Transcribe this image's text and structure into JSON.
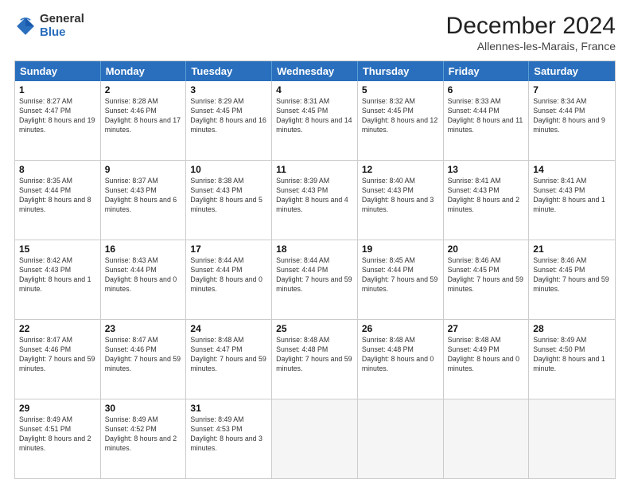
{
  "header": {
    "logo": {
      "general": "General",
      "blue": "Blue"
    },
    "title": "December 2024",
    "location": "Allennes-les-Marais, France"
  },
  "days": [
    "Sunday",
    "Monday",
    "Tuesday",
    "Wednesday",
    "Thursday",
    "Friday",
    "Saturday"
  ],
  "weeks": [
    [
      {
        "day": 1,
        "info": "Sunrise: 8:27 AM\nSunset: 4:47 PM\nDaylight: 8 hours and 19 minutes."
      },
      {
        "day": 2,
        "info": "Sunrise: 8:28 AM\nSunset: 4:46 PM\nDaylight: 8 hours and 17 minutes."
      },
      {
        "day": 3,
        "info": "Sunrise: 8:29 AM\nSunset: 4:45 PM\nDaylight: 8 hours and 16 minutes."
      },
      {
        "day": 4,
        "info": "Sunrise: 8:31 AM\nSunset: 4:45 PM\nDaylight: 8 hours and 14 minutes."
      },
      {
        "day": 5,
        "info": "Sunrise: 8:32 AM\nSunset: 4:45 PM\nDaylight: 8 hours and 12 minutes."
      },
      {
        "day": 6,
        "info": "Sunrise: 8:33 AM\nSunset: 4:44 PM\nDaylight: 8 hours and 11 minutes."
      },
      {
        "day": 7,
        "info": "Sunrise: 8:34 AM\nSunset: 4:44 PM\nDaylight: 8 hours and 9 minutes."
      }
    ],
    [
      {
        "day": 8,
        "info": "Sunrise: 8:35 AM\nSunset: 4:44 PM\nDaylight: 8 hours and 8 minutes."
      },
      {
        "day": 9,
        "info": "Sunrise: 8:37 AM\nSunset: 4:43 PM\nDaylight: 8 hours and 6 minutes."
      },
      {
        "day": 10,
        "info": "Sunrise: 8:38 AM\nSunset: 4:43 PM\nDaylight: 8 hours and 5 minutes."
      },
      {
        "day": 11,
        "info": "Sunrise: 8:39 AM\nSunset: 4:43 PM\nDaylight: 8 hours and 4 minutes."
      },
      {
        "day": 12,
        "info": "Sunrise: 8:40 AM\nSunset: 4:43 PM\nDaylight: 8 hours and 3 minutes."
      },
      {
        "day": 13,
        "info": "Sunrise: 8:41 AM\nSunset: 4:43 PM\nDaylight: 8 hours and 2 minutes."
      },
      {
        "day": 14,
        "info": "Sunrise: 8:41 AM\nSunset: 4:43 PM\nDaylight: 8 hours and 1 minute."
      }
    ],
    [
      {
        "day": 15,
        "info": "Sunrise: 8:42 AM\nSunset: 4:43 PM\nDaylight: 8 hours and 1 minute."
      },
      {
        "day": 16,
        "info": "Sunrise: 8:43 AM\nSunset: 4:44 PM\nDaylight: 8 hours and 0 minutes."
      },
      {
        "day": 17,
        "info": "Sunrise: 8:44 AM\nSunset: 4:44 PM\nDaylight: 8 hours and 0 minutes."
      },
      {
        "day": 18,
        "info": "Sunrise: 8:44 AM\nSunset: 4:44 PM\nDaylight: 7 hours and 59 minutes."
      },
      {
        "day": 19,
        "info": "Sunrise: 8:45 AM\nSunset: 4:44 PM\nDaylight: 7 hours and 59 minutes."
      },
      {
        "day": 20,
        "info": "Sunrise: 8:46 AM\nSunset: 4:45 PM\nDaylight: 7 hours and 59 minutes."
      },
      {
        "day": 21,
        "info": "Sunrise: 8:46 AM\nSunset: 4:45 PM\nDaylight: 7 hours and 59 minutes."
      }
    ],
    [
      {
        "day": 22,
        "info": "Sunrise: 8:47 AM\nSunset: 4:46 PM\nDaylight: 7 hours and 59 minutes."
      },
      {
        "day": 23,
        "info": "Sunrise: 8:47 AM\nSunset: 4:46 PM\nDaylight: 7 hours and 59 minutes."
      },
      {
        "day": 24,
        "info": "Sunrise: 8:48 AM\nSunset: 4:47 PM\nDaylight: 7 hours and 59 minutes."
      },
      {
        "day": 25,
        "info": "Sunrise: 8:48 AM\nSunset: 4:48 PM\nDaylight: 7 hours and 59 minutes."
      },
      {
        "day": 26,
        "info": "Sunrise: 8:48 AM\nSunset: 4:48 PM\nDaylight: 8 hours and 0 minutes."
      },
      {
        "day": 27,
        "info": "Sunrise: 8:48 AM\nSunset: 4:49 PM\nDaylight: 8 hours and 0 minutes."
      },
      {
        "day": 28,
        "info": "Sunrise: 8:49 AM\nSunset: 4:50 PM\nDaylight: 8 hours and 1 minute."
      }
    ],
    [
      {
        "day": 29,
        "info": "Sunrise: 8:49 AM\nSunset: 4:51 PM\nDaylight: 8 hours and 2 minutes."
      },
      {
        "day": 30,
        "info": "Sunrise: 8:49 AM\nSunset: 4:52 PM\nDaylight: 8 hours and 2 minutes."
      },
      {
        "day": 31,
        "info": "Sunrise: 8:49 AM\nSunset: 4:53 PM\nDaylight: 8 hours and 3 minutes."
      },
      null,
      null,
      null,
      null
    ]
  ]
}
